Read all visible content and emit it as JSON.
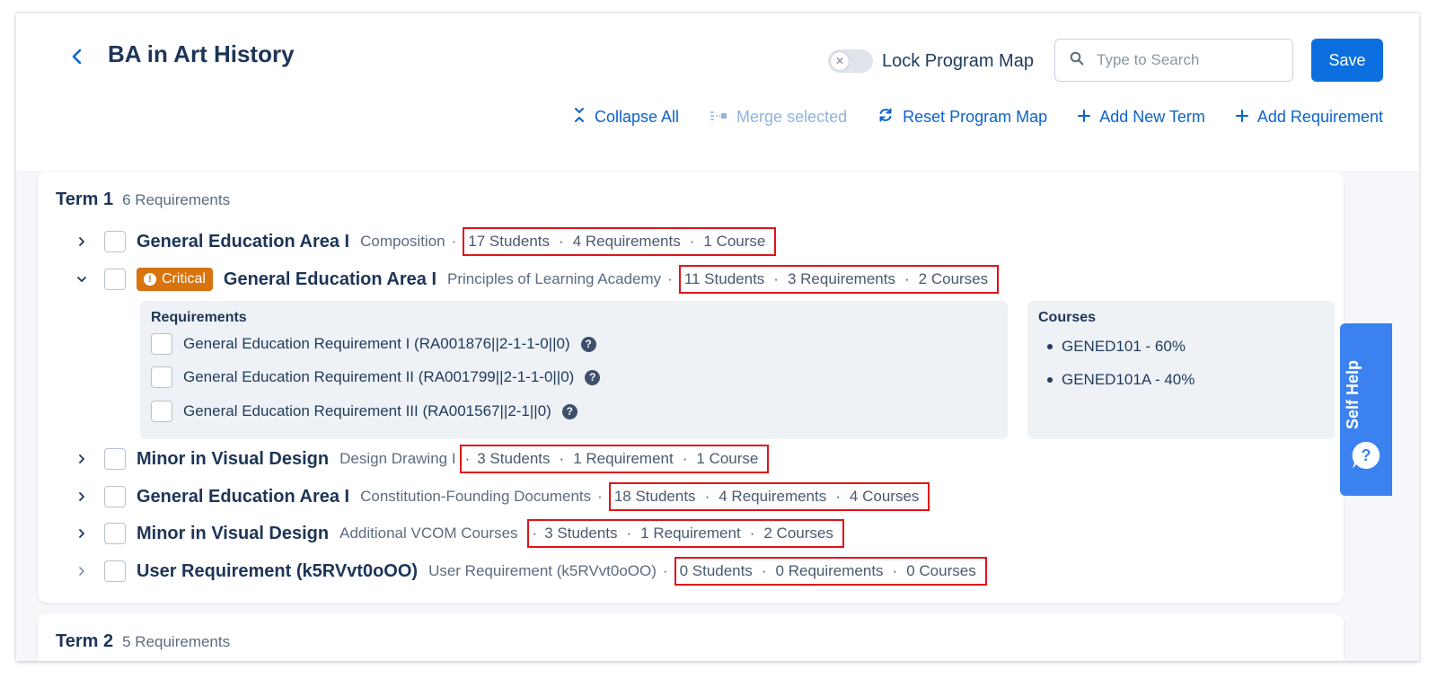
{
  "header": {
    "title": "BA in Art History",
    "lock_label": "Lock Program Map",
    "search_placeholder": "Type to Search",
    "save_label": "Save"
  },
  "toolbar": {
    "collapse_all": "Collapse All",
    "merge_selected": "Merge selected",
    "reset_program_map": "Reset Program Map",
    "add_new_term": "Add New Term",
    "add_requirement": "Add Requirement"
  },
  "term1": {
    "name": "Term 1",
    "count": "6 Requirements",
    "rows": [
      {
        "title": "General Education Area I",
        "subtitle": "Composition",
        "students": "17 Students",
        "requirements": "4 Requirements",
        "courses": "1 Course"
      },
      {
        "badge": "Critical",
        "title": "General Education Area I",
        "subtitle": "Principles of Learning Academy",
        "students": "11 Students",
        "requirements": "3 Requirements",
        "courses": "2 Courses"
      },
      {
        "title": "Minor in Visual Design",
        "subtitle": "Design Drawing I",
        "students": "3 Students",
        "requirements": "1 Requirement",
        "courses": "1 Course"
      },
      {
        "title": "General Education Area I",
        "subtitle": "Constitution-Founding Documents",
        "students": "18 Students",
        "requirements": "4 Requirements",
        "courses": "4 Courses"
      },
      {
        "title": "Minor in Visual Design",
        "subtitle": "Additional VCOM Courses",
        "students": "3 Students",
        "requirements": "1 Requirement",
        "courses": "2 Courses"
      },
      {
        "title": "User Requirement (k5RVvt0oOO)",
        "subtitle": "User Requirement (k5RVvt0oOO)",
        "students": "0 Students",
        "requirements": "0 Requirements",
        "courses": "0 Courses"
      }
    ],
    "expanded": {
      "requirements_title": "Requirements",
      "requirements": [
        "General Education Requirement I (RA001876||2-1-1-0||0)",
        "General Education Requirement II (RA001799||2-1-1-0||0)",
        "General Education Requirement III (RA001567||2-1||0)"
      ],
      "courses_title": "Courses",
      "courses": [
        "GENED101 - 60%",
        "GENED101A - 40%"
      ]
    }
  },
  "term2": {
    "name": "Term 2",
    "count": "5 Requirements"
  },
  "self_help": {
    "label": "Self Help"
  },
  "colors": {
    "primary": "#0b6fe0",
    "critical": "#d9730d",
    "highlight_box": "#e0131a",
    "self_help": "#3b82f0"
  }
}
